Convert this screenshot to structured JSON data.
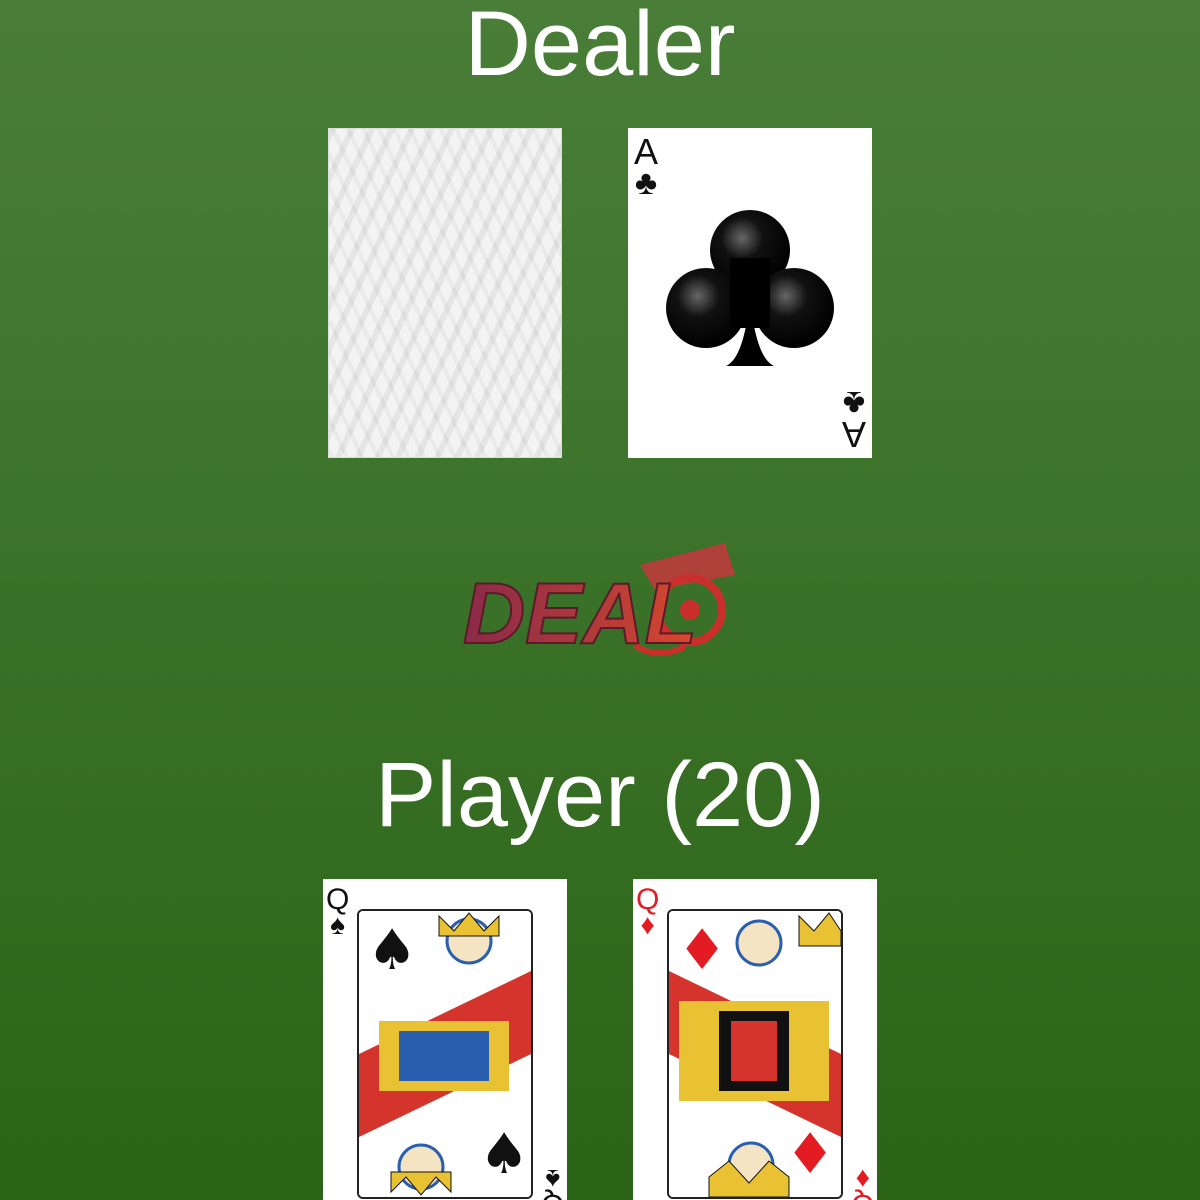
{
  "dealer": {
    "title": "Dealer",
    "cards": [
      {
        "face": "down",
        "icon": "card-back"
      },
      {
        "face": "up",
        "rank": "A",
        "suit": "♣",
        "suit_name": "clubs",
        "color": "#111111"
      }
    ]
  },
  "deal_button": {
    "label": "DEAL",
    "icon": "cannon-icon"
  },
  "player": {
    "title": "Player (20)",
    "cards": [
      {
        "face": "up",
        "rank": "Q",
        "suit": "♠",
        "suit_name": "spades",
        "color": "#111111"
      },
      {
        "face": "up",
        "rank": "Q",
        "suit": "♦",
        "suit_name": "diamonds",
        "color": "#e31b23"
      }
    ]
  },
  "colors": {
    "table_green": "#3a7128",
    "title_text": "#ffffff",
    "deal_red": "#c9302c",
    "deal_purple": "#8a2a4a"
  }
}
